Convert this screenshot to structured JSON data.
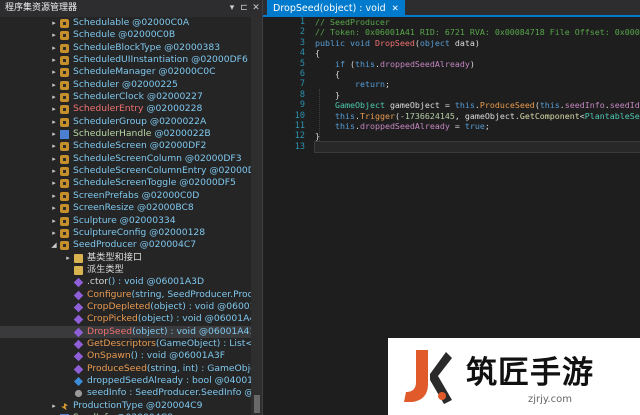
{
  "left_pane": {
    "title": "程序集资源管理器",
    "controls": [
      "▾",
      "⊏",
      "✕"
    ]
  },
  "tree": [
    {
      "indent": 1,
      "arrow": "▸",
      "icon": "class",
      "parts": [
        [
          "Schedulable",
          "type"
        ],
        [
          " @02000C0A",
          "tok"
        ]
      ]
    },
    {
      "indent": 1,
      "arrow": "▸",
      "icon": "class",
      "parts": [
        [
          "Schedule",
          "type"
        ],
        [
          " @02000C0B",
          "tok"
        ]
      ]
    },
    {
      "indent": 1,
      "arrow": "▸",
      "icon": "class",
      "parts": [
        [
          "ScheduleBlockType",
          "type"
        ],
        [
          " @02000383",
          "tok"
        ]
      ]
    },
    {
      "indent": 1,
      "arrow": "▸",
      "icon": "class",
      "parts": [
        [
          "ScheduledUIInstantiation",
          "type"
        ],
        [
          " @02000DF6",
          "tok"
        ]
      ]
    },
    {
      "indent": 1,
      "arrow": "▸",
      "icon": "class",
      "parts": [
        [
          "ScheduleManager",
          "type"
        ],
        [
          " @02000C0C",
          "tok"
        ]
      ]
    },
    {
      "indent": 1,
      "arrow": "▸",
      "icon": "class",
      "parts": [
        [
          "Scheduler",
          "type"
        ],
        [
          " @02000225",
          "tok"
        ]
      ]
    },
    {
      "indent": 1,
      "arrow": "▸",
      "icon": "class",
      "parts": [
        [
          "SchedulerClock",
          "type"
        ],
        [
          " @02000227",
          "tok"
        ]
      ]
    },
    {
      "indent": 1,
      "arrow": "▸",
      "icon": "class",
      "parts": [
        [
          "SchedulerEntry",
          "red"
        ],
        [
          " @02000228",
          "tok"
        ]
      ]
    },
    {
      "indent": 1,
      "arrow": "▸",
      "icon": "class",
      "parts": [
        [
          "SchedulerGroup",
          "type"
        ],
        [
          " @0200022A",
          "tok"
        ]
      ]
    },
    {
      "indent": 1,
      "arrow": "▸",
      "icon": "enum",
      "parts": [
        [
          "SchedulerHandle",
          "enum"
        ],
        [
          " @0200022B",
          "tok"
        ]
      ]
    },
    {
      "indent": 1,
      "arrow": "▸",
      "icon": "class",
      "parts": [
        [
          "ScheduleScreen",
          "type"
        ],
        [
          " @02000DF2",
          "tok"
        ]
      ]
    },
    {
      "indent": 1,
      "arrow": "▸",
      "icon": "class",
      "parts": [
        [
          "ScheduleScreenColumn",
          "type"
        ],
        [
          " @02000DF3",
          "tok"
        ]
      ]
    },
    {
      "indent": 1,
      "arrow": "▸",
      "icon": "class",
      "parts": [
        [
          "ScheduleScreenColumnEntry",
          "type"
        ],
        [
          " @02000DF4",
          "tok"
        ]
      ]
    },
    {
      "indent": 1,
      "arrow": "▸",
      "icon": "class",
      "parts": [
        [
          "ScheduleScreenToggle",
          "type"
        ],
        [
          " @02000DF5",
          "tok"
        ]
      ]
    },
    {
      "indent": 1,
      "arrow": "▸",
      "icon": "class",
      "parts": [
        [
          "ScreenPrefabs",
          "type"
        ],
        [
          " @02000C0D",
          "tok"
        ]
      ]
    },
    {
      "indent": 1,
      "arrow": "▸",
      "icon": "class",
      "parts": [
        [
          "ScreenResize",
          "type"
        ],
        [
          " @02000BC8",
          "tok"
        ]
      ]
    },
    {
      "indent": 1,
      "arrow": "▸",
      "icon": "class",
      "parts": [
        [
          "Sculpture",
          "type"
        ],
        [
          " @02000334",
          "tok"
        ]
      ]
    },
    {
      "indent": 1,
      "arrow": "▸",
      "icon": "class",
      "parts": [
        [
          "SculptureConfig",
          "type"
        ],
        [
          " @02000128",
          "tok"
        ]
      ]
    },
    {
      "indent": 1,
      "arrow": "◢",
      "icon": "class",
      "parts": [
        [
          "SeedProducer",
          "type"
        ],
        [
          " @020004C7",
          "tok"
        ]
      ]
    },
    {
      "indent": 2,
      "arrow": "▸",
      "icon": "folder",
      "parts": [
        [
          "基类型和接口",
          "white"
        ]
      ]
    },
    {
      "indent": 2,
      "arrow": "",
      "icon": "folder",
      "parts": [
        [
          "派生类型",
          "white"
        ]
      ]
    },
    {
      "indent": 2,
      "arrow": "",
      "icon": "method",
      "parts": [
        [
          ".ctor",
          "meth"
        ],
        [
          "() : void @06001A3D",
          "tok"
        ]
      ]
    },
    {
      "indent": 2,
      "arrow": "",
      "icon": "method",
      "parts": [
        [
          "Configure",
          "brown"
        ],
        [
          "(string, SeedProducer.Produc",
          "tok"
        ]
      ]
    },
    {
      "indent": 2,
      "arrow": "",
      "icon": "method",
      "parts": [
        [
          "CropDepleted",
          "brown"
        ],
        [
          "(object) : void @06001A4",
          "tok"
        ]
      ]
    },
    {
      "indent": 2,
      "arrow": "",
      "icon": "method",
      "parts": [
        [
          "CropPicked",
          "brown"
        ],
        [
          "(object) : void @06001A43",
          "tok"
        ]
      ]
    },
    {
      "indent": 2,
      "arrow": "",
      "icon": "method",
      "selected": true,
      "parts": [
        [
          "DropSeed",
          "red"
        ],
        [
          "(object) : void @06001A41",
          "tok"
        ]
      ]
    },
    {
      "indent": 2,
      "arrow": "",
      "icon": "method",
      "parts": [
        [
          "GetDescriptors",
          "brown"
        ],
        [
          "(GameObject) : List<Des",
          "tok"
        ]
      ]
    },
    {
      "indent": 2,
      "arrow": "",
      "icon": "method",
      "parts": [
        [
          "OnSpawn",
          "brown"
        ],
        [
          "() : void @06001A3F",
          "tok"
        ]
      ]
    },
    {
      "indent": 2,
      "arrow": "",
      "icon": "method",
      "parts": [
        [
          "ProduceSeed",
          "brown"
        ],
        [
          "(string, int) : GameObject",
          "tok"
        ]
      ]
    },
    {
      "indent": 2,
      "arrow": "",
      "icon": "field",
      "parts": [
        [
          "droppedSeedAlready",
          "type"
        ],
        [
          " : bool @0400163",
          "tok"
        ]
      ]
    },
    {
      "indent": 2,
      "arrow": "",
      "icon": "prop",
      "parts": [
        [
          "seedInfo",
          "type"
        ],
        [
          " : SeedProducer.SeedInfo @04",
          "tok"
        ]
      ]
    },
    {
      "indent": 1,
      "arrow": "▸",
      "icon": "event",
      "parts": [
        [
          "ProductionType",
          "type"
        ],
        [
          " @020004C9",
          "tok"
        ]
      ]
    },
    {
      "indent": 1,
      "arrow": "▸",
      "icon": "enum",
      "parts": [
        [
          "SeedInfo",
          "enum"
        ],
        [
          " @020004C8",
          "tok"
        ]
      ]
    }
  ],
  "tab": {
    "label": "DropSeed(object) : void",
    "close": "✕"
  },
  "code": {
    "line_numbers": [
      "1",
      "2",
      "3",
      "4",
      "5",
      "6",
      "7",
      "8",
      "9",
      "10",
      "11",
      "12",
      "13"
    ],
    "lines": [
      [
        [
          "// SeedProducer",
          "com"
        ]
      ],
      [
        [
          "// Token: 0x06001A41 RID: 6721 RVA: 0x00084718 File Offset: 0x00082918",
          "com"
        ]
      ],
      [
        [
          "public ",
          "kw"
        ],
        [
          "void ",
          "kw"
        ],
        [
          "DropSeed",
          "red"
        ],
        [
          "(",
          "pun"
        ],
        [
          "object ",
          "kw"
        ],
        [
          "data",
          "pun"
        ],
        [
          ")",
          "pun"
        ]
      ],
      [
        [
          "{",
          "pun"
        ]
      ],
      [
        [
          "    ",
          "pun"
        ],
        [
          "if ",
          "kw"
        ],
        [
          "(",
          "pun"
        ],
        [
          "this",
          "kw"
        ],
        [
          ".",
          "pun"
        ],
        [
          "droppedSeedAlready",
          "field"
        ],
        [
          ")",
          "pun"
        ]
      ],
      [
        [
          "    {",
          "pun"
        ]
      ],
      [
        [
          "        ",
          "pun"
        ],
        [
          "return",
          "kw"
        ],
        [
          ";",
          "pun"
        ]
      ],
      [
        [
          "    }",
          "pun"
        ]
      ],
      [
        [
          "    ",
          "pun"
        ],
        [
          "GameObject ",
          "ty"
        ],
        [
          "gameObject = ",
          "pun"
        ],
        [
          "this",
          "kw"
        ],
        [
          ".",
          "pun"
        ],
        [
          "ProduceSeed",
          "call"
        ],
        [
          "(",
          "pun"
        ],
        [
          "this",
          "kw"
        ],
        [
          ".",
          "pun"
        ],
        [
          "seedInfo",
          "field"
        ],
        [
          ".",
          "pun"
        ],
        [
          "seedId",
          "field"
        ],
        [
          ", ",
          "pun"
        ],
        [
          "1",
          "num"
        ],
        [
          ");",
          "pun"
        ]
      ],
      [
        [
          "    ",
          "pun"
        ],
        [
          "this",
          "kw"
        ],
        [
          ".",
          "pun"
        ],
        [
          "Trigger",
          "call"
        ],
        [
          "(",
          "pun"
        ],
        [
          "-1736624145",
          "num"
        ],
        [
          ", gameObject.",
          "pun"
        ],
        [
          "GetComponent",
          "meth"
        ],
        [
          "<",
          "pun"
        ],
        [
          "PlantableSeed",
          "ty"
        ],
        [
          ">());",
          "pun"
        ]
      ],
      [
        [
          "    ",
          "pun"
        ],
        [
          "this",
          "kw"
        ],
        [
          ".",
          "pun"
        ],
        [
          "droppedSeedAlready",
          "field"
        ],
        [
          " = ",
          "pun"
        ],
        [
          "true",
          "kw"
        ],
        [
          ";",
          "pun"
        ]
      ],
      [
        [
          "}",
          "pun"
        ]
      ],
      [
        [
          "",
          "pun"
        ]
      ]
    ]
  },
  "watermark": {
    "brand": "筑匠手游",
    "url": "zjrjy.com"
  }
}
